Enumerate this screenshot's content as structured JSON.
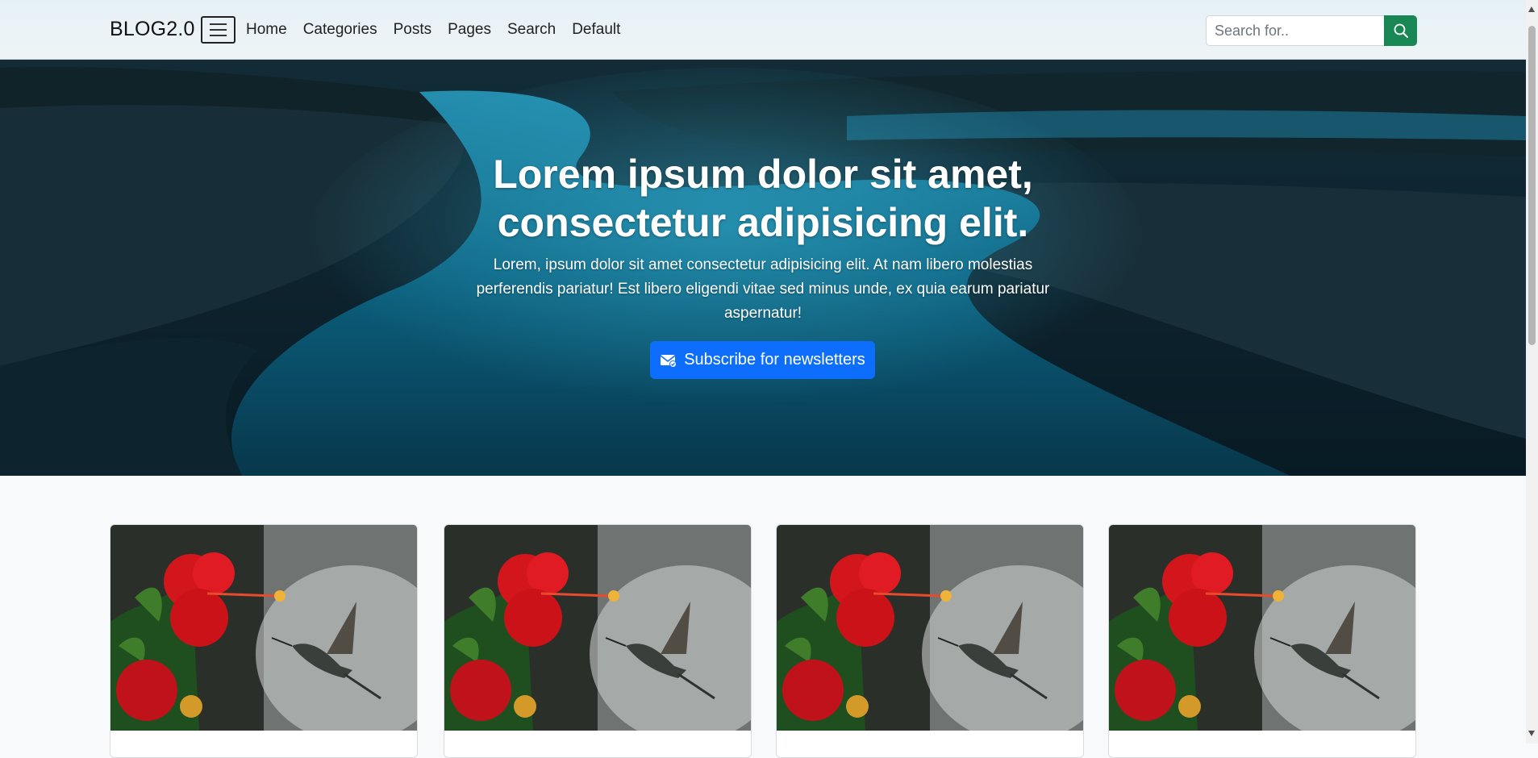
{
  "navbar": {
    "brand": "BLOG2.0",
    "links": [
      "Home",
      "Categories",
      "Posts",
      "Pages",
      "Search",
      "Default"
    ],
    "search_placeholder": "Search for.."
  },
  "hero": {
    "title_line1": "Lorem ipsum dolor sit amet,",
    "title_line2": "consectetur adipisicing elit.",
    "text": "Lorem, ipsum dolor sit amet consectetur adipisicing elit. At nam libero molestias perferendis pariatur! Est libero eligendi vitae sed minus unde, ex quia earum pariatur aspernatur!",
    "button_label": "Subscribe for newsletters"
  },
  "cards_count": 4,
  "colors": {
    "primary": "#0d6efd",
    "success": "#198754",
    "hero_water": "#0f6f93"
  }
}
